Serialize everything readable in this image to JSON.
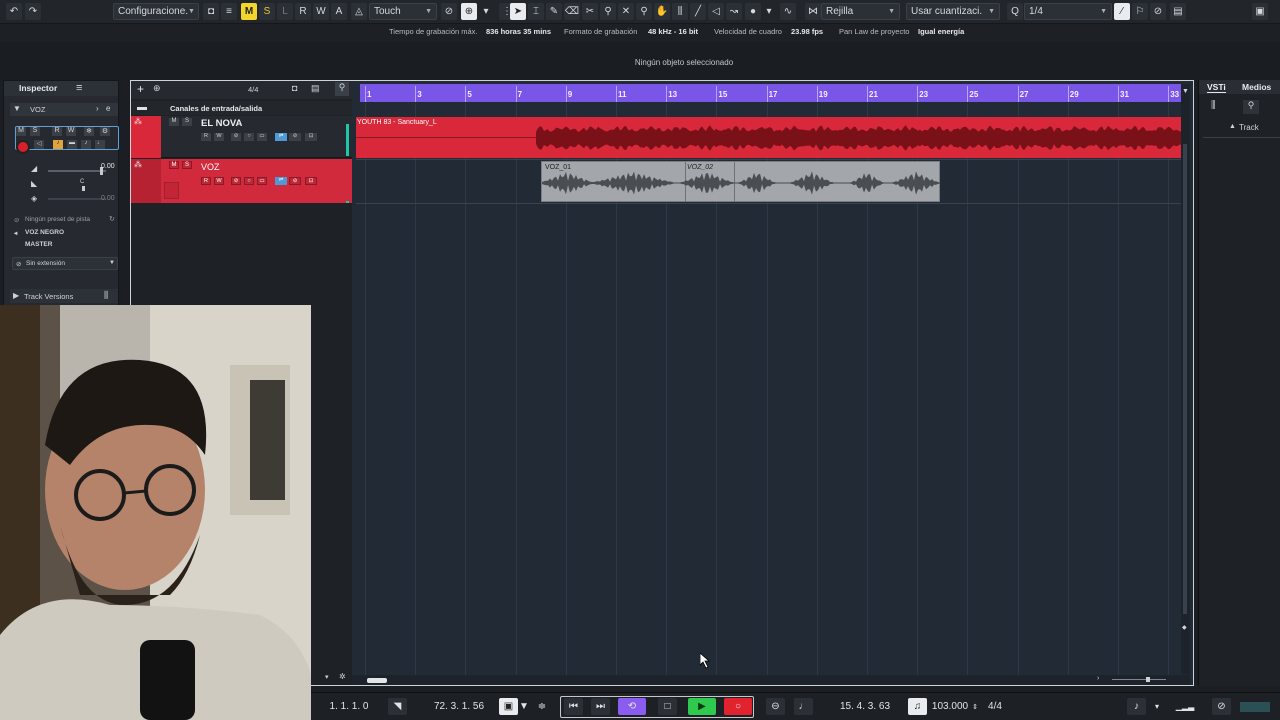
{
  "toolbar": {
    "undo_icon": "undo-icon",
    "redo_icon": "redo-icon",
    "config_select": "Configuracione.",
    "mode_buttons": [
      "M",
      "S",
      "L",
      "R",
      "W",
      "A"
    ],
    "automation_mode": "Touch",
    "snap_type": "Rejilla",
    "quantize_label": "Usar cuantizaci.",
    "quantize_value": "1/4"
  },
  "status": {
    "rec_time_label": "Tiempo de grabación máx.",
    "rec_time_value": "836 horas 35 mins",
    "format_label": "Formato de grabación",
    "format_value": "48 kHz - 16 bit",
    "frame_label": "Velocidad de cuadro",
    "frame_value": "23.98 fps",
    "panlaw_label": "Pan Law de proyecto",
    "panlaw_value": "Igual energía"
  },
  "info_line": "Ningún objeto seleccionado",
  "inspector": {
    "tab": "Inspector",
    "track_name": "VOZ",
    "volume": "0.00",
    "pan": "C",
    "delay": "0.00",
    "preset": "Ningún preset de pista",
    "output_1": "VOZ NEGRO",
    "output_2": "MASTER",
    "extension": "Sin extensión",
    "track_versions": "Track Versions"
  },
  "tracklist": {
    "time_sig": "4/4",
    "folder": "Canales de entrada/salida",
    "tracks": [
      {
        "num": "1",
        "name": "EL NOVA"
      },
      {
        "num": "2",
        "name": "VOZ"
      }
    ]
  },
  "ruler": {
    "bars": [
      "1",
      "3",
      "5",
      "7",
      "9",
      "11",
      "13",
      "15",
      "17",
      "19",
      "21",
      "23",
      "25",
      "27",
      "29",
      "31",
      "33"
    ]
  },
  "events": {
    "audio_1": "YOUTH 83 - Sanctuary_L",
    "voz_1": "VOZ_01",
    "voz_2": "VOZ_02"
  },
  "rightpanel": {
    "tab_vsti": "VSTi",
    "tab_medios": "Medios",
    "track_label": "Track"
  },
  "transport": {
    "left_locator": "1. 1. 1.   0",
    "right_locator": "72. 3. 1. 56",
    "position": "15. 4. 3. 63",
    "tempo": "103.000",
    "signature": "4/4"
  },
  "colors": {
    "ruler": "#7a56e8",
    "track_red": "#d8283a",
    "track_selected": "#d02a3c",
    "event_gray": "#a3a6aa",
    "play_green": "#2fc94d",
    "record_red": "#e0232e",
    "cycle_purple": "#8a5cf0"
  }
}
